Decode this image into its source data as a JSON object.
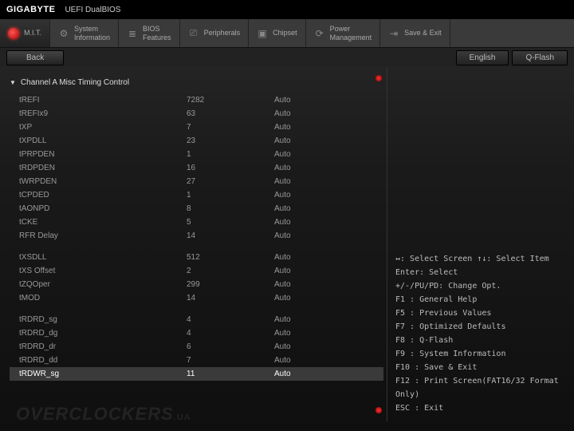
{
  "header": {
    "brand": "GIGABYTE",
    "sub": "UEFI DualBIOS"
  },
  "tabs": [
    {
      "label": "M.I.T.",
      "icon": "dot"
    },
    {
      "label": "System\nInformation",
      "icon": "gear"
    },
    {
      "label": "BIOS\nFeatures",
      "icon": "list"
    },
    {
      "label": "Peripherals",
      "icon": "periph"
    },
    {
      "label": "Chipset",
      "icon": "chip"
    },
    {
      "label": "Power\nManagement",
      "icon": "power"
    },
    {
      "label": "Save & Exit",
      "icon": "exit"
    }
  ],
  "subbar": {
    "back": "Back",
    "english": "English",
    "qflash": "Q-Flash"
  },
  "section": "Channel A Misc Timing Control",
  "rows1": [
    {
      "name": "tREFI",
      "val": "7282",
      "auto": "Auto"
    },
    {
      "name": "tREFIx9",
      "val": "63",
      "auto": "Auto"
    },
    {
      "name": "tXP",
      "val": "7",
      "auto": "Auto"
    },
    {
      "name": "tXPDLL",
      "val": "23",
      "auto": "Auto"
    },
    {
      "name": "tPRPDEN",
      "val": "1",
      "auto": "Auto"
    },
    {
      "name": "tRDPDEN",
      "val": "16",
      "auto": "Auto"
    },
    {
      "name": "tWRPDEN",
      "val": "27",
      "auto": "Auto"
    },
    {
      "name": "tCPDED",
      "val": "1",
      "auto": "Auto"
    },
    {
      "name": "tAONPD",
      "val": "8",
      "auto": "Auto"
    },
    {
      "name": "tCKE",
      "val": "5",
      "auto": "Auto"
    },
    {
      "name": "RFR Delay",
      "val": "14",
      "auto": "Auto"
    }
  ],
  "rows2": [
    {
      "name": "tXSDLL",
      "val": "512",
      "auto": "Auto"
    },
    {
      "name": "tXS Offset",
      "val": "2",
      "auto": "Auto"
    },
    {
      "name": "tZQOper",
      "val": "299",
      "auto": "Auto"
    },
    {
      "name": "tMOD",
      "val": "14",
      "auto": "Auto"
    }
  ],
  "rows3": [
    {
      "name": "tRDRD_sg",
      "val": "4",
      "auto": "Auto"
    },
    {
      "name": "tRDRD_dg",
      "val": "4",
      "auto": "Auto"
    },
    {
      "name": "tRDRD_dr",
      "val": "6",
      "auto": "Auto"
    },
    {
      "name": "tRDRD_dd",
      "val": "7",
      "auto": "Auto"
    },
    {
      "name": "tRDWR_sg",
      "val": "11",
      "auto": "Auto"
    }
  ],
  "selected_index": 4,
  "help": [
    "↔: Select Screen   ↑↓: Select Item",
    "Enter: Select",
    "+/-/PU/PD: Change Opt.",
    "F1  : General Help",
    "F5  : Previous Values",
    "F7  : Optimized Defaults",
    "F8  : Q-Flash",
    "F9  : System Information",
    "F10 : Save & Exit",
    "F12 : Print Screen(FAT16/32 Format Only)",
    "ESC : Exit"
  ],
  "watermark": "OVERCLOCKERS",
  "watermark_suffix": ".UA",
  "icons": {
    "gear": "⚙",
    "list": "≣",
    "periph": "⎚",
    "chip": "▣",
    "power": "⟳",
    "exit": "⇥"
  }
}
